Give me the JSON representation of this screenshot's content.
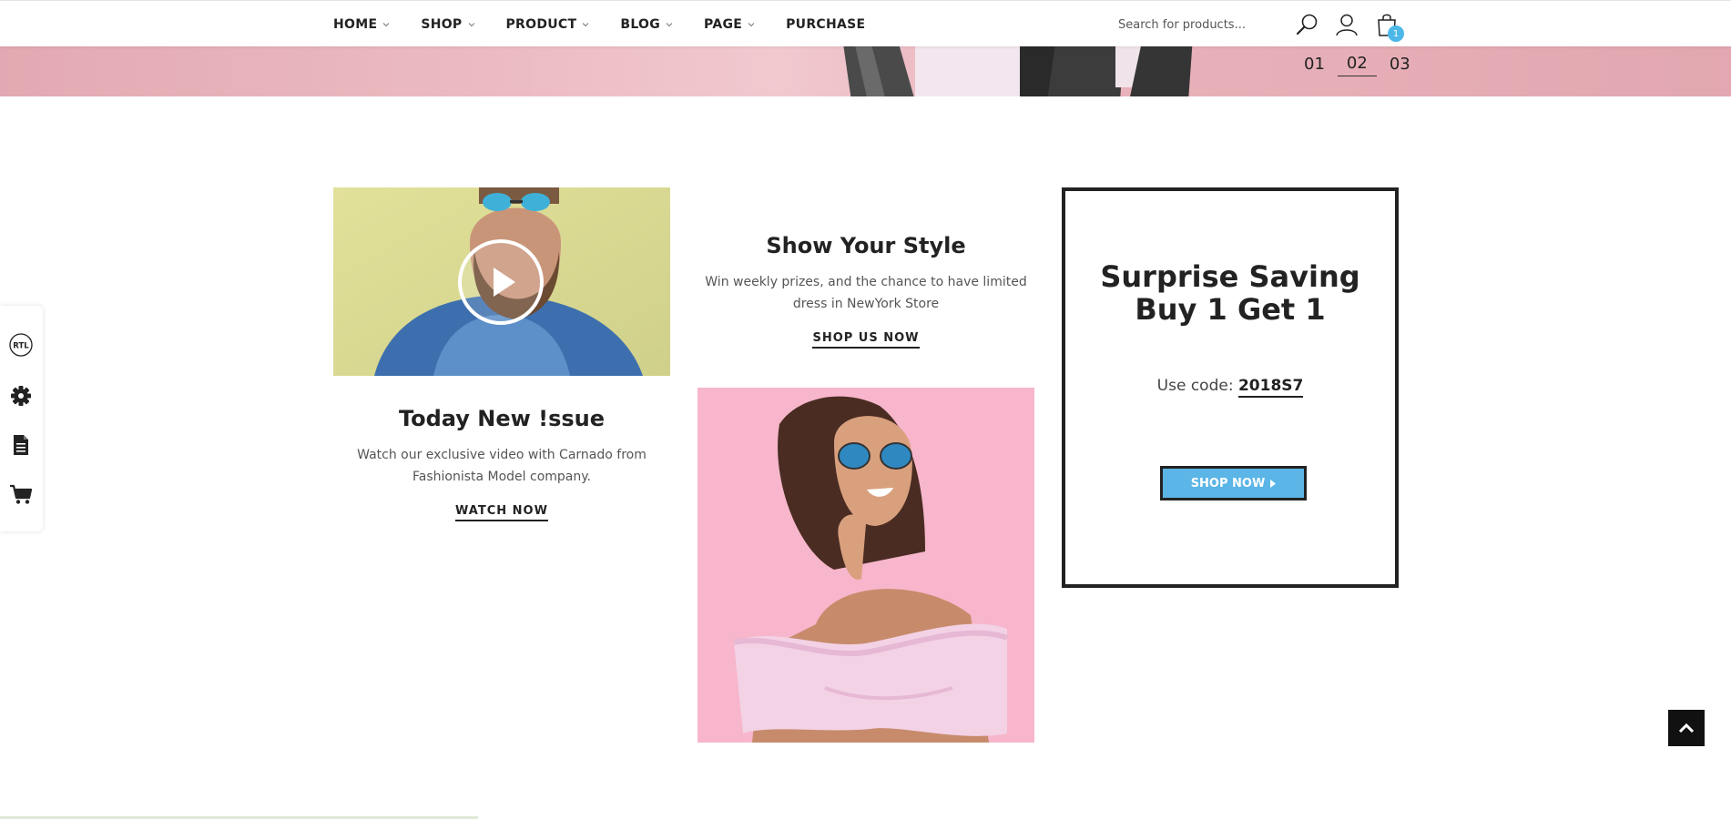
{
  "nav": {
    "items": [
      {
        "label": "HOME",
        "has_dropdown": true
      },
      {
        "label": "SHOP",
        "has_dropdown": true
      },
      {
        "label": "PRODUCT",
        "has_dropdown": true
      },
      {
        "label": "BLOG",
        "has_dropdown": true
      },
      {
        "label": "PAGE",
        "has_dropdown": true
      },
      {
        "label": "PURCHASE",
        "has_dropdown": false
      }
    ],
    "search_placeholder": "Search for products...",
    "search_icon": "search-icon",
    "account_icon": "user-icon",
    "cart_icon": "shopping-bag-icon",
    "cart_count": "1"
  },
  "hero": {
    "countdown": [
      "01",
      "02",
      "03"
    ]
  },
  "sidetool": {
    "icons": [
      "rtl-icon",
      "gear-icon",
      "document-icon",
      "cart-icon"
    ],
    "rtl_label": "RTL"
  },
  "video_card": {
    "title": "Today New !ssue",
    "description": "Watch our exclusive video with Carnado from Fashionista Model company.",
    "link": "WATCH NOW"
  },
  "style_card": {
    "title": "Show Your Style",
    "description": "Win weekly prizes, and the chance to have limited dress in NewYork Store",
    "link": "SHOP US NOW"
  },
  "promo": {
    "title_line1": "Surprise Saving",
    "title_line2": "Buy 1 Get 1",
    "code_label": "Use code:",
    "code": "2018S7",
    "button": "SHOP NOW"
  },
  "colors": {
    "accent": "#5bb5e6",
    "hero_pink": "#e9b3bb",
    "pink_bg": "#f7b6cb",
    "dark": "#222222"
  }
}
